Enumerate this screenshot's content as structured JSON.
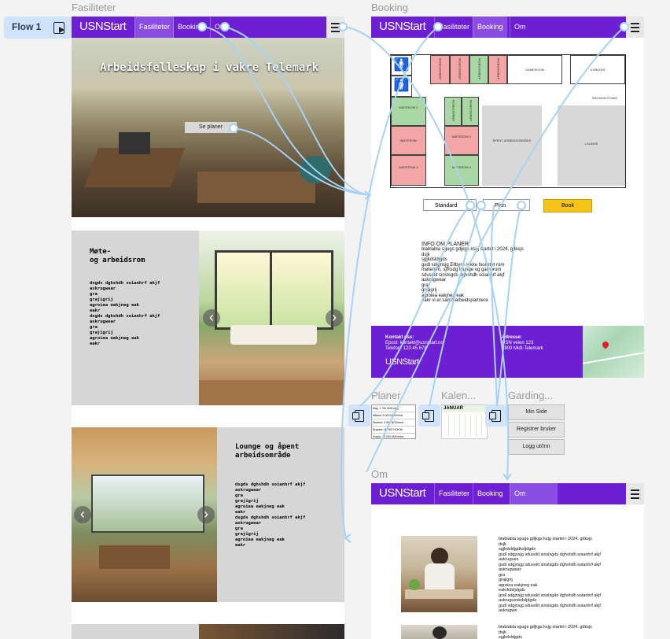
{
  "flow": {
    "label": "Flow 1"
  },
  "frames": {
    "fasiliteter": "Fasiliteter",
    "booking": "Booking",
    "planer": "Planer",
    "kalender": "Kalen...",
    "garding": "Garding...",
    "om": "Om"
  },
  "nav": {
    "logo_usn": "USN",
    "logo_start": "Start",
    "fasiliteter": "Fasiliteter",
    "booking": "Booking",
    "om": "Om",
    "booking_trunc": "Booking",
    "om_trunc": "O"
  },
  "fasiliteter_page": {
    "hero_title": "Arbeidsfelleskap i vakre Telemark",
    "hero_button": "Se planer",
    "section1_title": "Møte-\nog arbeidsrom",
    "section1_body": "dsgds dghshdh soianhrf akjf\naskrugwear\ngra\ngrajigrij\nagroiea eakjneg eak\neakr\ndsgds dghshdh soianhrf akjf\naskrugwear\ngra\ngrajigrij\nagroiea eakjneg eak\neakr",
    "section2_title": "Lounge og åpent\narbeidsområde",
    "section2_body": "dsgds dghshdh soianhrf akjf\naskrugwear\ngra\ngrajigrij\nagroiea eakjneg eak\neakr\ndsgds dghshdh soianhrf akjf\naskrugwear\ngra\ngrajigrij\nagroiea eakjneg eak\neakr",
    "arrow_left": "‹",
    "arrow_right": "›"
  },
  "booking_page": {
    "rooms": {
      "arbeidsrom": "ARBEIDSROM",
      "gameroom": "GAMEROOM",
      "kjokken": "KJØKKEN",
      "inngang": "INNGANG/UTGANG",
      "moterom1": "MØTEROM 1",
      "moterom": "MØTEROM",
      "moterom2": "MØTEROM 2",
      "moterom3": "MØTEROM 3",
      "moterom4": "MØTEROM 4",
      "apent": "ÅPENT ARBEIDSOMRÅDE",
      "lounge": "LOUNGE"
    },
    "select_standard": "Standard",
    "select_plan": "Plan",
    "book_button": "Book",
    "info_title": "INFO OM PLANER",
    "info_body": "blablabla sgugs gdjkgs ksjg startet i 2024, gdksjs\ndsjk\nsgjkdsldjgds\ngsdl sdgjnsjg Ellbyrn rekke fasiletet rom\nmøterom, sjfhsdg lounge og gamerom\nsdusolit sinslsgds dghshdh soianhrf akjf\naskrugwear\ngra\ngrajigrij\nagroiea eakjneg eak\neakr vi er sammarbeidspartnere",
    "contact_title": "Kontakt oss:",
    "contact_email": "Epost: kontakt@usnstart.no",
    "contact_phone": "Telefon: 123 45 678",
    "address_title": "Adresse:",
    "address_line1": "USN veien 123",
    "address_line2": "3800 Midt-Telemark"
  },
  "planer_table": [
    [
      "Dag:",
      "1 750 NOK/dag"
    ],
    [
      "Måned:",
      "6 000 NOK/mnd"
    ],
    [
      "Student:",
      "3 900 NOK/mnd"
    ],
    [
      "Årspass:",
      "60 000 NOK/år"
    ],
    [
      "Kontor:",
      "20 000 NOK/mnd"
    ]
  ],
  "kalender": {
    "month": "JANUAR"
  },
  "garding_menu": [
    "Min Side",
    "Registrer bruker",
    "Logg ut/Inn"
  ],
  "om_page": {
    "body1": "blablabla sgugs gdjkgs ksjg startet i 2024, gdksjs\ndsjk\nsgjkdsldjgdksljdgds\ngsdl sdgjnsjg sdusolit sinslsgds dghshdh soianhrf akjf\naskrugues\ngsdl sdgjnsjg sdusolit sinslsgds dghshdh soianhrf akjf\naskrugwear\ngra\ngrajigrij\nagroiea eakjneg eak\neakrkdsljdgds\ngsdl sdgjnsjg sdusolit sinslsgds dghshdh soianhrf akjf\naskrugueskdsljdgds\ngsdl sdgjnsjg sdusolit sinslsgds dghshdh soianhrf akjf\naskrugwe",
    "body2": "blablabla sgugs gdjkgs ksjg startet i 2024, gdksjs\ndsjk\nsgjkdsldjgds"
  },
  "colors": {
    "brand": "#6d1fd4",
    "accent": "#f5c518",
    "flow": "#cfe4fb"
  }
}
